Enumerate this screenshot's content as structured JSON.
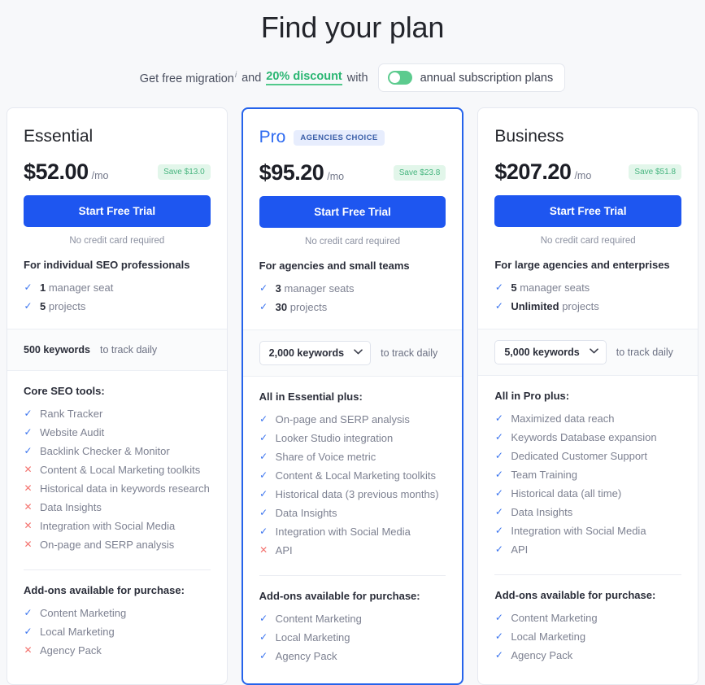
{
  "header": {
    "title": "Find your plan",
    "promo_prefix": "Get free migration",
    "promo_sup": "i",
    "promo_and": "and",
    "promo_discount": "20% discount",
    "promo_with": "with",
    "toggle_label": "annual subscription plans",
    "toggle_on": true,
    "colors": {
      "discount_green": "#2bb673",
      "toggle_track": "#5ccb8e",
      "cta_blue": "#1e56f0",
      "featured_border": "#2563eb",
      "check_blue": "#3b74ef",
      "cross_red": "#f4736f"
    }
  },
  "plans": [
    {
      "name": "Essential",
      "badge": null,
      "featured": false,
      "price": "$52.00",
      "period": "/mo",
      "save": "Save $13.0",
      "cta": "Start Free Trial",
      "cta_note": "No credit card required",
      "audience_title": "For individual SEO professionals",
      "audience_features": [
        {
          "mark": "yes",
          "strong": "1",
          "text": "manager seat"
        },
        {
          "mark": "yes",
          "strong": "5",
          "text": "projects"
        }
      ],
      "keywords_type": "static",
      "keywords_value": "500 keywords",
      "keywords_suffix": "to track daily",
      "section_title": "Core SEO tools:",
      "features": [
        {
          "mark": "yes",
          "text": "Rank Tracker"
        },
        {
          "mark": "yes",
          "text": "Website Audit"
        },
        {
          "mark": "yes",
          "text": "Backlink Checker & Monitor"
        },
        {
          "mark": "no",
          "text": "Content & Local Marketing toolkits"
        },
        {
          "mark": "no",
          "text": "Historical data in keywords research"
        },
        {
          "mark": "no",
          "text": "Data Insights"
        },
        {
          "mark": "no",
          "text": "Integration with Social Media"
        },
        {
          "mark": "no",
          "text": "On-page and SERP analysis"
        }
      ],
      "addons_title": "Add-ons available for purchase:",
      "addons": [
        {
          "mark": "yes",
          "text": "Content Marketing"
        },
        {
          "mark": "yes",
          "text": "Local Marketing"
        },
        {
          "mark": "no",
          "text": "Agency Pack"
        }
      ]
    },
    {
      "name": "Pro",
      "badge": "AGENCIES CHOICE",
      "featured": true,
      "price": "$95.20",
      "period": "/mo",
      "save": "Save $23.8",
      "cta": "Start Free Trial",
      "cta_note": "No credit card required",
      "audience_title": "For agencies and small teams",
      "audience_features": [
        {
          "mark": "yes",
          "strong": "3",
          "text": "manager seats"
        },
        {
          "mark": "yes",
          "strong": "30",
          "text": "projects"
        }
      ],
      "keywords_type": "select",
      "keywords_value": "2,000 keywords",
      "keywords_suffix": "to track daily",
      "section_title": "All in Essential plus:",
      "features": [
        {
          "mark": "yes",
          "text": "On-page and SERP analysis"
        },
        {
          "mark": "yes",
          "text": "Looker Studio integration"
        },
        {
          "mark": "yes",
          "text": "Share of Voice metric"
        },
        {
          "mark": "yes",
          "text": "Content & Local Marketing toolkits"
        },
        {
          "mark": "yes",
          "text": "Historical data (3 previous months)"
        },
        {
          "mark": "yes",
          "text": "Data Insights"
        },
        {
          "mark": "yes",
          "text": "Integration with Social Media"
        },
        {
          "mark": "no",
          "text": "API"
        }
      ],
      "addons_title": "Add-ons available for purchase:",
      "addons": [
        {
          "mark": "yes",
          "text": "Content Marketing"
        },
        {
          "mark": "yes",
          "text": "Local Marketing"
        },
        {
          "mark": "yes",
          "text": "Agency Pack"
        }
      ]
    },
    {
      "name": "Business",
      "badge": null,
      "featured": false,
      "price": "$207.20",
      "period": "/mo",
      "save": "Save $51.8",
      "cta": "Start Free Trial",
      "cta_note": "No credit card required",
      "audience_title": "For large agencies and enterprises",
      "audience_features": [
        {
          "mark": "yes",
          "strong": "5",
          "text": "manager seats"
        },
        {
          "mark": "yes",
          "strong": "Unlimited",
          "text": "projects"
        }
      ],
      "keywords_type": "select",
      "keywords_value": "5,000 keywords",
      "keywords_suffix": "to track daily",
      "section_title": "All in Pro plus:",
      "features": [
        {
          "mark": "yes",
          "text": "Maximized data reach"
        },
        {
          "mark": "yes",
          "text": "Keywords Database expansion"
        },
        {
          "mark": "yes",
          "text": "Dedicated Customer Support"
        },
        {
          "mark": "yes",
          "text": "Team Training"
        },
        {
          "mark": "yes",
          "text": "Historical data (all time)"
        },
        {
          "mark": "yes",
          "text": "Data Insights"
        },
        {
          "mark": "yes",
          "text": "Integration with Social Media"
        },
        {
          "mark": "yes",
          "text": "API"
        }
      ],
      "addons_title": "Add-ons available for purchase:",
      "addons": [
        {
          "mark": "yes",
          "text": "Content Marketing"
        },
        {
          "mark": "yes",
          "text": "Local Marketing"
        },
        {
          "mark": "yes",
          "text": "Agency Pack"
        }
      ]
    }
  ],
  "icons": {
    "check": "✓",
    "cross": "✕",
    "chevron_down": "❯"
  }
}
